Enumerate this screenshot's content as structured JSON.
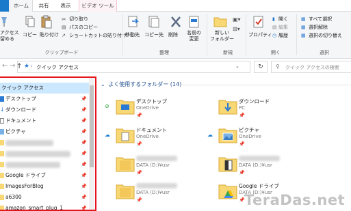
{
  "ribbon_tabs": {
    "file": "",
    "home": "ホーム",
    "share": "共有",
    "view": "表示",
    "video_tools": "ビデオ ツール"
  },
  "ribbon": {
    "pin_label_1": "アクセス",
    "pin_label_2": "留める",
    "copy": "コピー",
    "paste": "貼り付け",
    "cut": "切り取り",
    "copy_path": "パスのコピー",
    "paste_shortcut": "ショートカットの貼り付け",
    "group_clipboard": "クリップボード",
    "move_to": "移動先",
    "copy_to": "コピー先",
    "delete": "削除",
    "rename_1": "名前の",
    "rename_2": "変更",
    "group_organize": "整理",
    "new_folder_1": "新しい",
    "new_folder_2": "フォルダー",
    "group_new": "新規",
    "properties": "プロパティ",
    "open": "開く",
    "edit": "編集",
    "history": "履歴",
    "group_open": "開く",
    "select_all": "すべて選択",
    "select_none": "選択解除",
    "invert_selection": "選択の切り替え",
    "group_select": "選択"
  },
  "address": {
    "path": "クイック アクセス",
    "search_placeholder": "クイック アクセスの検索"
  },
  "nav": {
    "quick_access": "クイック アクセス",
    "items": [
      {
        "label": "デスクトップ",
        "icon": "desktop-icon"
      },
      {
        "label": "ダウンロード",
        "icon": "download-icon"
      },
      {
        "label": "ドキュメント",
        "icon": "document-icon"
      },
      {
        "label": "ピクチャ",
        "icon": "picture-icon"
      },
      {
        "label": "",
        "icon": "folder-icon"
      },
      {
        "label": "",
        "icon": "folder-icon"
      },
      {
        "label": "",
        "icon": "folder-icon"
      },
      {
        "label": "Google ドライブ",
        "icon": "folder-icon"
      },
      {
        "label": "ImagesForBlog",
        "icon": "folder-icon"
      },
      {
        "label": "a6300",
        "icon": "folder-icon"
      },
      {
        "label": "amazon_smart_plug_1",
        "icon": "folder-icon"
      }
    ]
  },
  "content": {
    "section_title": "よく使用するフォルダー (14)",
    "tiles": [
      {
        "name": "デスクトップ",
        "sub": "OneDrive"
      },
      {
        "name": "ダウンロード",
        "sub": "PC"
      },
      {
        "name": "ドキュメント",
        "sub": "OneDrive"
      },
      {
        "name": "ピクチャ",
        "sub": "OneDrive"
      },
      {
        "name": "",
        "sub": "DATA (D:)¥usr"
      },
      {
        "name": "",
        "sub": "DATA (D:)¥usr"
      },
      {
        "name": "",
        "sub": "DATA (D:)¥usr"
      },
      {
        "name": "Google ドライブ",
        "sub": "DATA (D:)¥usr"
      }
    ]
  },
  "watermark": "TeraDas.net",
  "colors": {
    "accent": "#1979ca",
    "selection": "#cce8ff",
    "highlight_frame": "#e4161b",
    "folder": "#f8d775",
    "sync_ok": "#3aa54a",
    "sync_cloud": "#1b7fd1"
  }
}
